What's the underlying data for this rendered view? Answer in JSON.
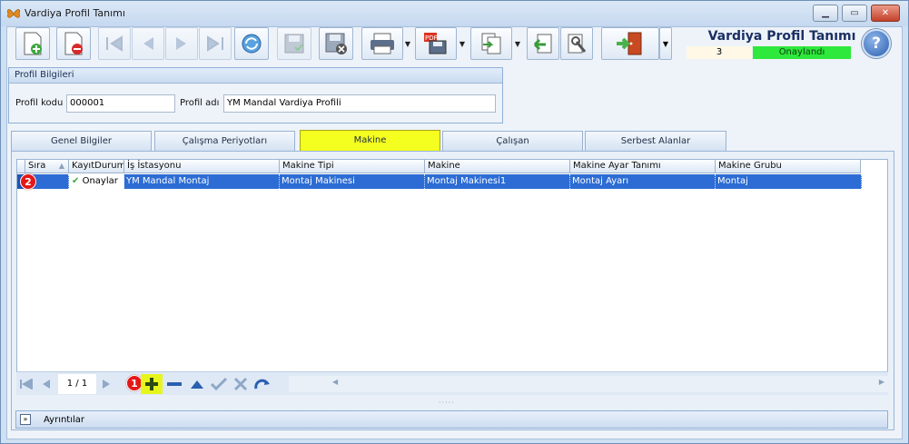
{
  "window": {
    "title": "Vardiya Profil Tanımı"
  },
  "header": {
    "title": "Vardiya Profil Tanımı",
    "count": "3",
    "status": "Onaylandı",
    "status_color": "#2ee83c"
  },
  "profil": {
    "caption": "Profil Bilgileri",
    "kod_label": "Profil kodu",
    "kod_value": "000001",
    "ad_label": "Profil adı",
    "ad_value": "YM Mandal Vardiya Profili"
  },
  "tabs": [
    {
      "label": "Genel Bilgiler"
    },
    {
      "label": "Çalışma Periyotları"
    },
    {
      "label": "Makine"
    },
    {
      "label": "Çalışan"
    },
    {
      "label": "Serbest Alanlar"
    }
  ],
  "grid": {
    "columns": [
      "Sıra",
      "KayıtDurum",
      "İş İstasyonu",
      "Makine Tipi",
      "Makine",
      "Makine Ayar Tanımı",
      "Makine Grubu"
    ],
    "row": {
      "sira": "",
      "kayit": "Onaylar",
      "istasyon": "YM Mandal Montaj",
      "tipi": "Montaj Makinesi",
      "makine": "Montaj Makinesi1",
      "ayar": "Montaj Ayarı",
      "grup": "Montaj"
    }
  },
  "navigator": {
    "page": "1 / 1"
  },
  "badges": {
    "one": "1",
    "two": "2"
  },
  "details": {
    "label": "Ayrıntılar"
  },
  "colors": {
    "selection": "#2c6cd4",
    "active_tab": "#f5ff1f"
  }
}
